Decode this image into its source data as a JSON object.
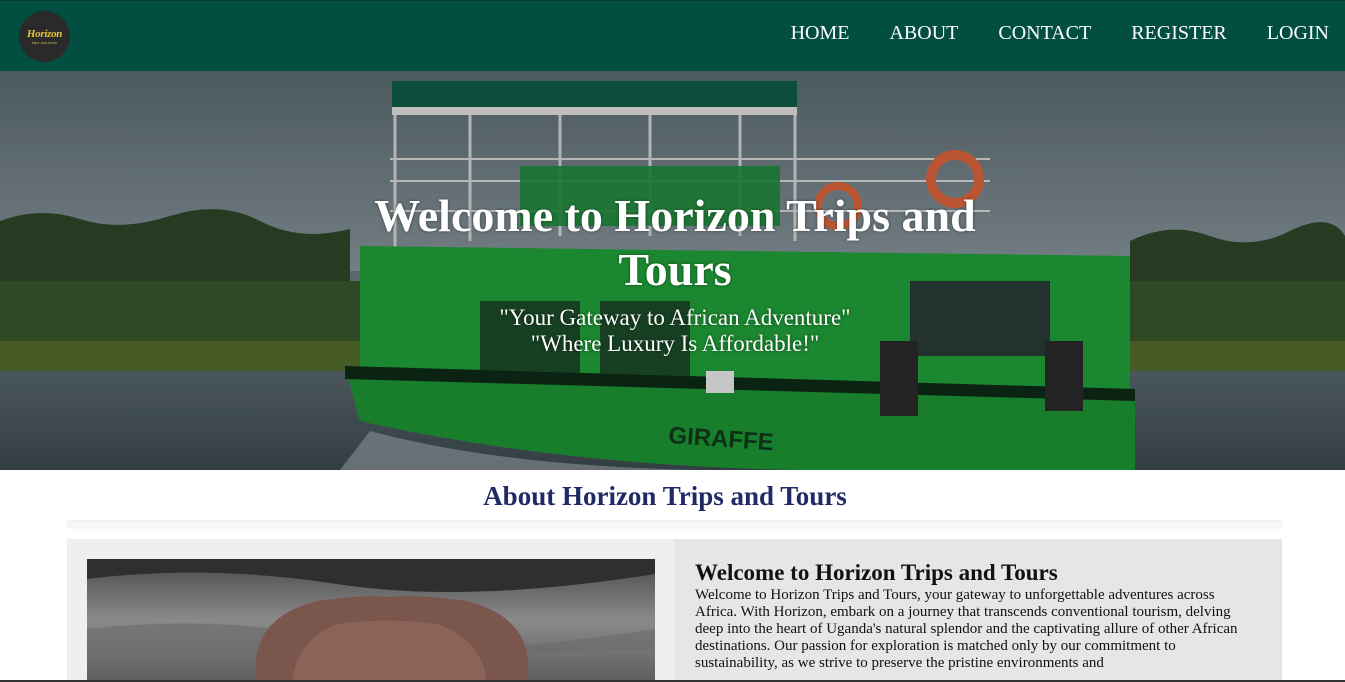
{
  "brand": {
    "logo_text": "Horizon",
    "logo_tagline": "trips and tours"
  },
  "nav": {
    "items": [
      {
        "label": "HOME"
      },
      {
        "label": "ABOUT"
      },
      {
        "label": "CONTACT"
      },
      {
        "label": "REGISTER"
      },
      {
        "label": "LOGIN"
      }
    ]
  },
  "hero": {
    "title": "Welcome to Horizon Trips and Tours",
    "subtitle_1": "\"Your Gateway to African Adventure\"",
    "subtitle_2": "\"Where Luxury Is Affordable!\"",
    "boat_name": "GIRAFFE"
  },
  "about": {
    "heading": "About Horizon Trips and Tours",
    "card_title": "Welcome to Horizon Trips and Tours",
    "card_body": "Welcome to Horizon Trips and Tours, your gateway to unforgettable adventures across Africa. With Horizon, embark on a journey that transcends conventional tourism, delving deep into the heart of Uganda's natural splendor and the captivating allure of other African destinations. Our passion for exploration is matched only by our commitment to sustainability, as we strive to preserve the pristine environments and"
  },
  "colors": {
    "nav_bg": "#024f42",
    "heading_blue": "#1f2a66",
    "boat_green": "#1faa3c"
  }
}
